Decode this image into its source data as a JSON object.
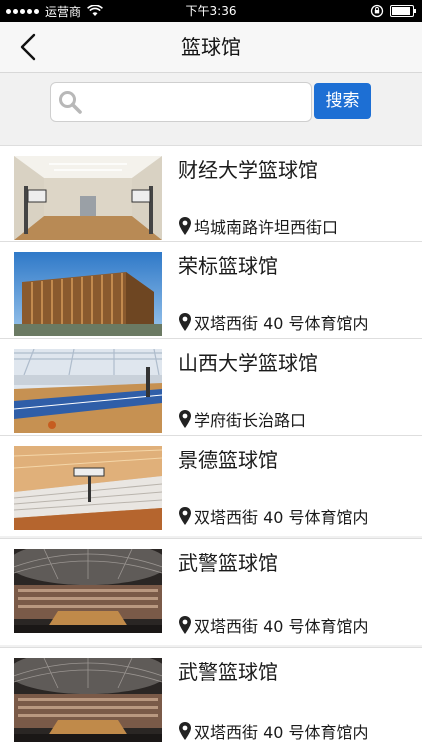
{
  "status_bar": {
    "carrier": "运营商",
    "time": "下午3:36"
  },
  "header": {
    "title": "篮球馆",
    "back_icon": "chevron-left-icon"
  },
  "search": {
    "placeholder": "",
    "value": "",
    "button_label": "搜索",
    "icon": "search-icon",
    "button_color": "#1d6fd4"
  },
  "venues": [
    {
      "name": "财经大学篮球馆",
      "address": "坞城南路许坦西街口",
      "image": "indoor-court-photo"
    },
    {
      "name": "荣标篮球馆",
      "address": "双塔西街 40 号体育馆内",
      "image": "building-exterior-photo"
    },
    {
      "name": "山西大学篮球馆",
      "address": "学府街长治路口",
      "image": "indoor-court-photo"
    },
    {
      "name": "景德篮球馆",
      "address": "双塔西街 40 号体育馆内",
      "image": "indoor-court-photo"
    },
    {
      "name": "武警篮球馆",
      "address": "双塔西街 40 号体育馆内",
      "image": "arena-photo"
    },
    {
      "name": "武警篮球馆",
      "address": "双塔西街 40 号体育馆内",
      "image": "arena-photo"
    }
  ]
}
